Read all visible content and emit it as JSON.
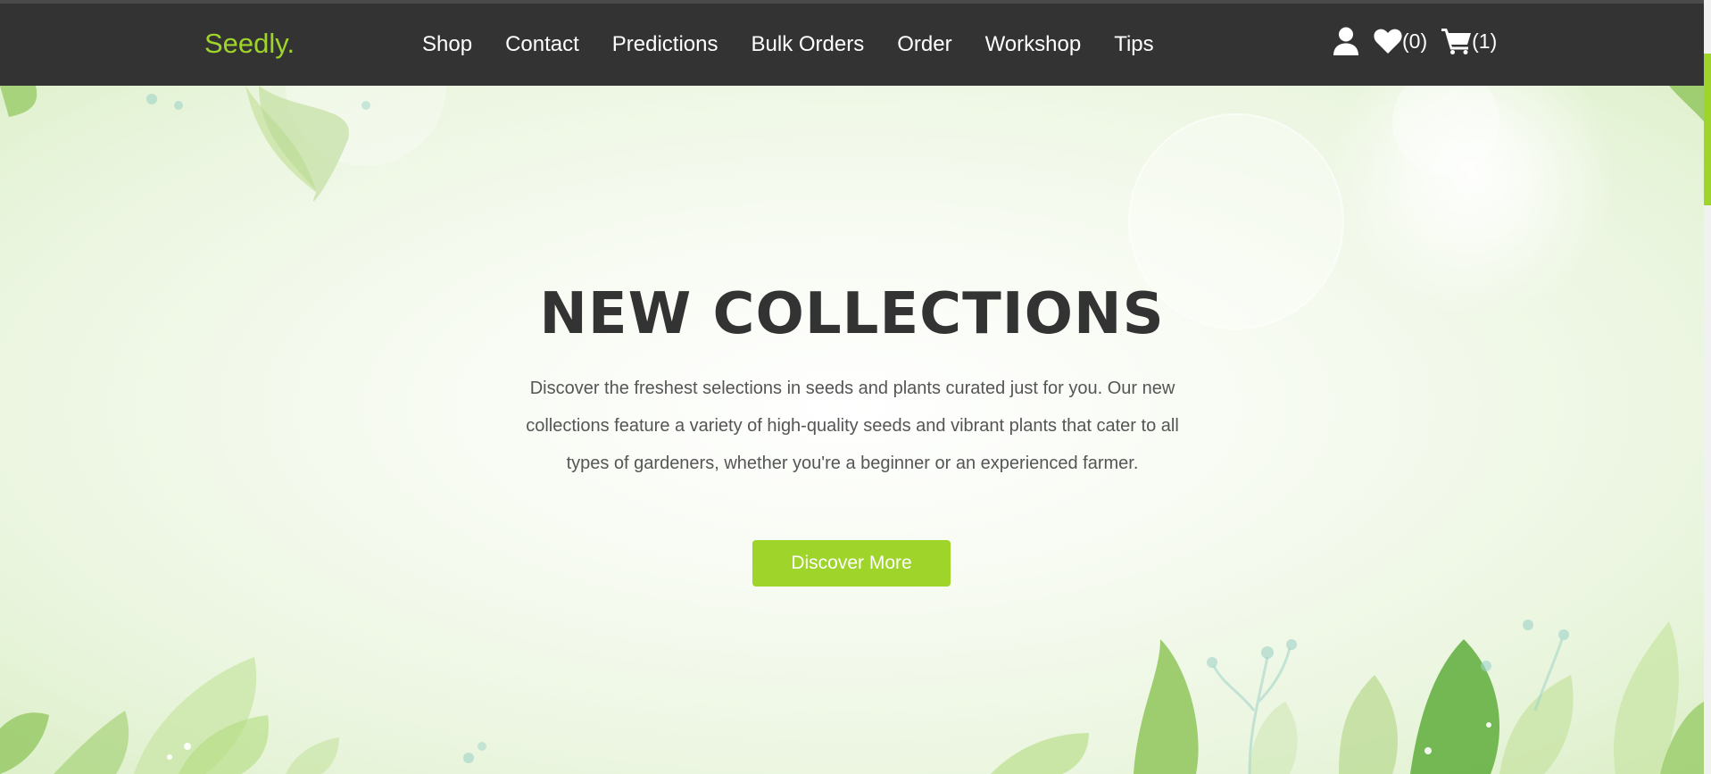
{
  "brand": {
    "name": "Seedly."
  },
  "nav": {
    "links": [
      "Shop",
      "Contact",
      "Predictions",
      "Bulk Orders",
      "Order",
      "Workshop",
      "Tips"
    ]
  },
  "header_icons": {
    "account_icon": "user-icon",
    "wishlist_icon": "heart-icon",
    "wishlist_count": "(0)",
    "cart_icon": "cart-icon",
    "cart_count": "(1)"
  },
  "hero": {
    "title": "NEW COLLECTIONS",
    "description": "Discover the freshest selections in seeds and plants curated just for you. Our new collections feature a variety of high-quality seeds and vibrant plants that cater to all types of gardeners, whether you're a beginner or an experienced farmer.",
    "cta_label": "Discover More"
  },
  "colors": {
    "accent": "#9fd42a",
    "navbar": "#333333",
    "heading": "#333333",
    "body_text": "#555555"
  }
}
